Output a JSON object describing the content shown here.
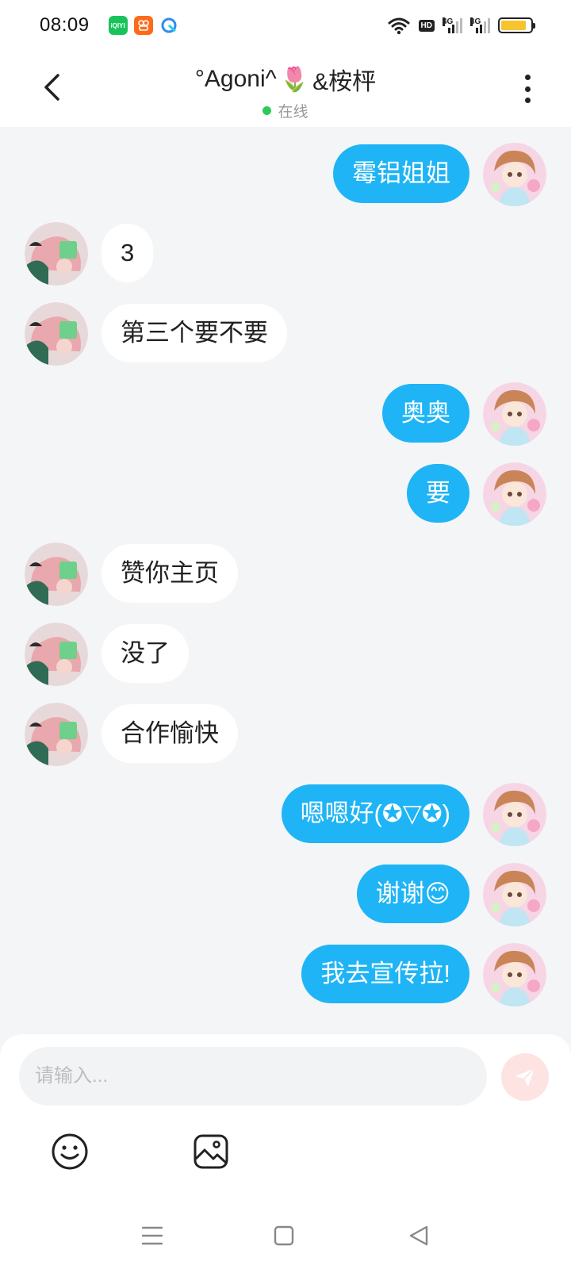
{
  "status_bar": {
    "time": "08:09",
    "apps": [
      {
        "icon": "iqiyi-app-icon",
        "text": "iQIYI",
        "color": "#19c35b"
      },
      {
        "icon": "kuaishou-app-icon",
        "text": "",
        "color": "#ff6a1a"
      },
      {
        "icon": "browser-app-icon",
        "text": "",
        "color": "#2f8cf0"
      }
    ],
    "hd_label": "HD",
    "network_1": "4G",
    "network_2": "3G",
    "battery_level": 0.85,
    "battery_color": "#f7c32e"
  },
  "header": {
    "contact_name_prefix": "°Agoni^",
    "contact_name_suffix": "&桉枰",
    "title_emoji": "🌷",
    "status": "在线",
    "status_color": "#2ec95b"
  },
  "messages": [
    {
      "side": "self",
      "text": "霉铝姐姐"
    },
    {
      "side": "other",
      "text": "3"
    },
    {
      "side": "other",
      "text": "第三个要不要"
    },
    {
      "side": "self",
      "text": "奥奥"
    },
    {
      "side": "self",
      "text": "要"
    },
    {
      "side": "other",
      "text": "赞你主页"
    },
    {
      "side": "other",
      "text": "没了"
    },
    {
      "side": "other",
      "text": "合作愉快"
    },
    {
      "side": "self",
      "text": "嗯嗯好(✪▽✪)"
    },
    {
      "side": "self",
      "text": "谢谢😊"
    },
    {
      "side": "self",
      "text": "我去宣传拉!"
    }
  ],
  "input": {
    "placeholder": "请输入...",
    "value": ""
  },
  "colors": {
    "self_bubble": "#1fb4f5",
    "other_bubble": "#ffffff",
    "background": "#f4f5f7",
    "send_button": "#fde3e1"
  },
  "icons": {
    "back": "back-arrow-icon",
    "more": "more-vertical-icon",
    "send": "send-icon",
    "emoji": "emoji-icon",
    "image": "image-icon",
    "nav_menu": "menu-icon",
    "nav_home": "home-icon",
    "nav_back": "nav-back-icon"
  }
}
